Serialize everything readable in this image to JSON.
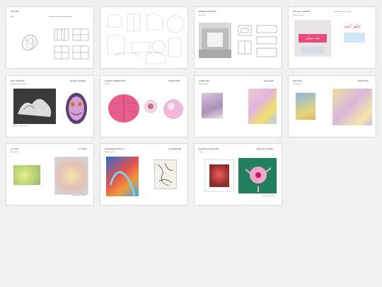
{
  "pages": [
    {
      "id": 1,
      "header_left": "Olin / 2024",
      "sub": "Work",
      "caption": "Sketch - drawing for dining table and chairs project, outlines on the tabletop, plan for a dining room with plans and installation layout."
    },
    {
      "id": 2,
      "header_left": "",
      "sub": "",
      "caption": ""
    },
    {
      "id": 3,
      "header_left": "Exhibition Design 2024",
      "sub": "Work / Year",
      "caption": "Installation view / wall element study"
    },
    {
      "id": 4,
      "header_left": "Arbor Law / Joya 2023",
      "sub": "Edition / Process",
      "caption": "Typographic banner work with Arabic letterforms, poster sequence and installation notes for public display.",
      "arabic_banner": "بيت مولى",
      "arabic_sign": "حلم انت"
    },
    {
      "id": 5,
      "header_left": "Mural - Work 2024",
      "header_right": "Paintings, Installation",
      "sub": "Materials: acrylic, wood",
      "caption": "Mural, courtyard, 2024"
    },
    {
      "id": 6,
      "header_left": "Interactive installation 2024",
      "header_right": "Sculpture 2024",
      "sub": "Medium",
      "caption": ""
    },
    {
      "id": 7,
      "header_left": "Portraits 2024",
      "header_right": "Figures 2024",
      "sub": "Digital painting",
      "caption": ""
    },
    {
      "id": 8,
      "header_left": "Series 2023",
      "header_right": "Painting 2023",
      "sub": "Oil on canvas",
      "caption": "Oil on canvas, framed composition series"
    },
    {
      "id": 9,
      "header_left": "CC / 2023",
      "header_right": "CC / 2023",
      "sub": "Mixed media",
      "caption": "Painting, canvas, 2023"
    },
    {
      "id": 10,
      "header_left": "Studio Abstract Series 1, 2",
      "header_right": "Ink drawing 2022",
      "sub": "Acrylic on panel",
      "caption": ""
    },
    {
      "id": 11,
      "header_left": "Illustration & portraits 2023",
      "header_right": "Watercolour, ink 2023",
      "sub": "Work",
      "caption": "Ink on paper, 2023"
    }
  ]
}
